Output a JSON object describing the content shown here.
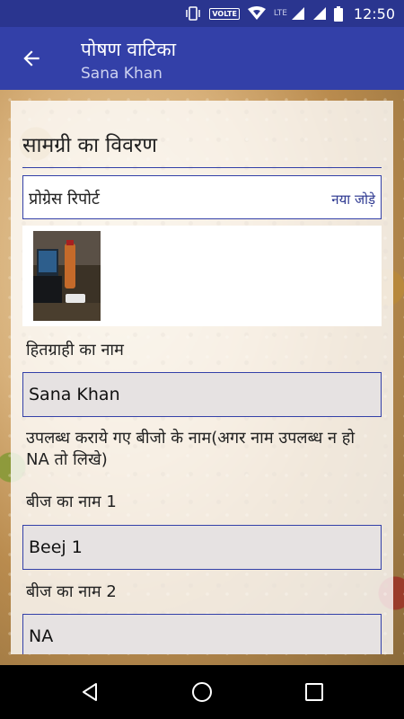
{
  "status_bar": {
    "time": "12:50",
    "volte": "VOLTE",
    "lte": "LTE"
  },
  "app_bar": {
    "title": "पोषण वाटिका",
    "subtitle": "Sana Khan"
  },
  "form": {
    "section_title": "सामग्री का विवरण",
    "progress_report_label": "प्रोग्रेस रिपोर्ट",
    "add_new_label": "नया जोड़े",
    "beneficiary_label": "हितग्राही का नाम",
    "beneficiary_value": "Sana Khan",
    "seeds_provided_label": "उपलब्ध कराये गए बीजो के नाम(अगर नाम उपलब्ध न हो NA तो लिखे)",
    "seed_1_label": "बीज का नाम 1",
    "seed_1_value": "Beej 1",
    "seed_2_label": "बीज का नाम 2",
    "seed_2_value": "NA"
  },
  "icons": {
    "back": "arrow-left",
    "nav_back": "triangle-left",
    "nav_home": "circle",
    "nav_recents": "square"
  },
  "colors": {
    "primary": "#3340A8",
    "primary_dark": "#2A358F",
    "input_bg": "#e6e2e2"
  }
}
